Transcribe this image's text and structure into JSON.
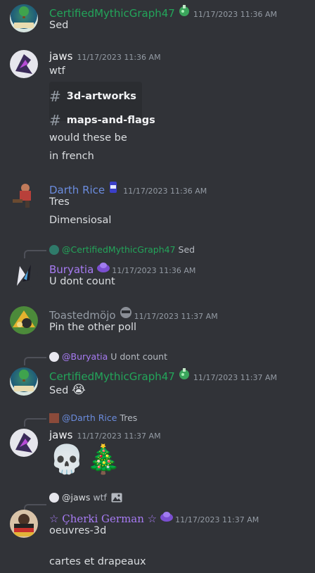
{
  "messages": [
    {
      "username": "CertifiedMythicGraph47",
      "timestamp": "11/17/2023 11:36 AM",
      "lines": [
        "Sed"
      ],
      "name_color": "#23a55a",
      "badge_icon": "potion-icon"
    },
    {
      "username": "jaws",
      "timestamp": "11/17/2023 11:36 AM",
      "lines": [
        "wtf",
        "would these be",
        "in french"
      ],
      "name_color": "#f2f3f5",
      "channels": [
        "3d-artworks",
        "maps-and-flags"
      ]
    },
    {
      "username": "Darth Rice",
      "timestamp": "11/17/2023 11:36 AM",
      "lines": [
        "Tres",
        "Dimensiosal"
      ],
      "name_color": "#6b8cde",
      "badge_icon": "can-icon"
    },
    {
      "reply_to": "@CertifiedMythicGraph47",
      "reply_text": "Sed",
      "username": "Buryatia",
      "timestamp": "11/17/2023 11:36 AM",
      "lines": [
        "U dont count"
      ],
      "name_color": "#a77bf3",
      "badge_icon": "slime-icon"
    },
    {
      "username": "Toastedmöjo",
      "timestamp": "11/17/2023 11:37 AM",
      "lines": [
        "Pin the other poll"
      ],
      "name_color": "#949ba4",
      "badge_icon": "helmet-icon"
    },
    {
      "reply_to": "@Buryatia",
      "reply_text": "U dont count",
      "username": "CertifiedMythicGraph47",
      "timestamp": "11/17/2023 11:37 AM",
      "lines": [
        "Sed"
      ],
      "name_color": "#23a55a",
      "badge_icon": "potion-icon",
      "emoji": "😭"
    },
    {
      "reply_to": "@Darth Rice",
      "reply_text": "Tres",
      "username": "jaws",
      "timestamp": "11/17/2023 11:37 AM",
      "emojis": [
        "💀",
        "🎄"
      ],
      "name_color": "#f2f3f5"
    },
    {
      "reply_to": "@jaws",
      "reply_text": "wtf",
      "reply_icon": "image-icon",
      "username": "☆ Çherki German ☆",
      "timestamp": "11/17/2023 11:37 AM",
      "lines": [
        "oeuvres-3d",
        "cartes et drapeaux"
      ],
      "name_color": "#a77bf3",
      "badge_icon": "slime-icon"
    }
  ]
}
